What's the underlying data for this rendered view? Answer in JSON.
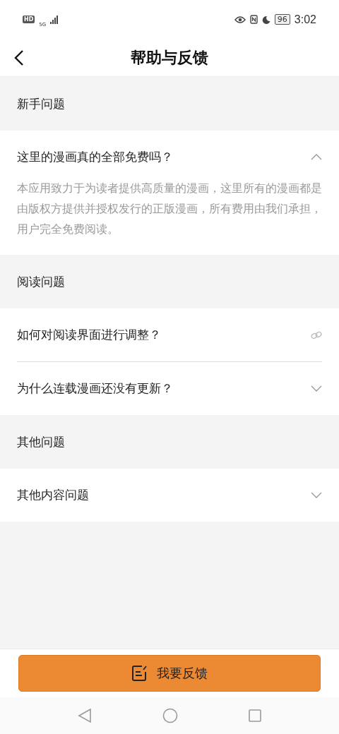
{
  "status_bar": {
    "hd": "HD",
    "network": "5G",
    "battery": "96",
    "time": "3:02"
  },
  "header": {
    "title": "帮助与反馈"
  },
  "sections": [
    {
      "title": "新手问题",
      "items": [
        {
          "kind": "expand",
          "question": "这里的漫画真的全部免费吗？",
          "expanded": true,
          "answer": "本应用致力于为读者提供高质量的漫画，这里所有的漫画都是由版权方提供并授权发行的正版漫画，所有费用由我们承担，用户完全免费阅读。"
        }
      ]
    },
    {
      "title": "阅读问题",
      "items": [
        {
          "kind": "link",
          "question": "如何对阅读界面进行调整？"
        },
        {
          "kind": "expand",
          "question": "为什么连载漫画还没有更新？",
          "expanded": false
        }
      ]
    },
    {
      "title": "其他问题",
      "items": [
        {
          "kind": "expand",
          "question": "其他内容问题",
          "expanded": false
        }
      ]
    }
  ],
  "feedback_button": {
    "label": "我要反馈"
  }
}
